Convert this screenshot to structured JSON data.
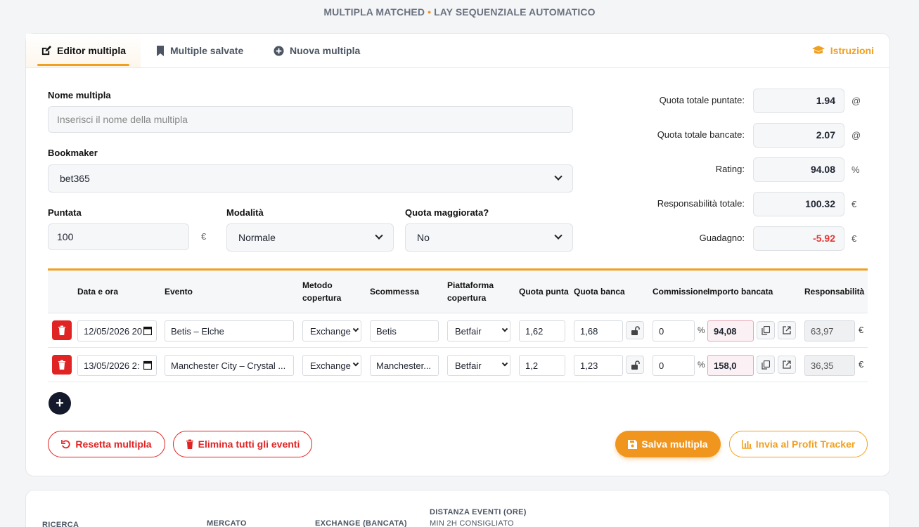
{
  "page": {
    "title": "MULTIPLA MATCHED",
    "separator": "•",
    "subtitle": "LAY SEQUENZIALE AUTOMATICO"
  },
  "tabs": [
    {
      "label": "Editor multipla",
      "icon": "edit-icon",
      "active": true
    },
    {
      "label": "Multiple salvate",
      "icon": "bookmark-icon",
      "active": false
    },
    {
      "label": "Nuova multipla",
      "icon": "plus-circle-icon",
      "active": false
    }
  ],
  "instructions": {
    "label": "Istruzioni",
    "icon": "graduation-cap-icon"
  },
  "form": {
    "name_label": "Nome multipla",
    "name_placeholder": "Inserisci il nome della multipla",
    "bookmaker_label": "Bookmaker",
    "bookmaker_value": "bet365",
    "stake_label": "Puntata",
    "stake_value": "100",
    "stake_unit": "€",
    "mode_label": "Modalità",
    "mode_value": "Normale",
    "boosted_label": "Quota maggiorata?",
    "boosted_value": "No"
  },
  "summary": [
    {
      "label": "Quota totale puntate:",
      "value": "1.94",
      "unit": "@"
    },
    {
      "label": "Quota totale bancate:",
      "value": "2.07",
      "unit": "@"
    },
    {
      "label": "Rating:",
      "value": "94.08",
      "unit": "%"
    },
    {
      "label": "Responsabilità totale:",
      "value": "100.32",
      "unit": "€"
    },
    {
      "label": "Guadagno:",
      "value": "-5.92",
      "unit": "€",
      "color": "#e53935"
    }
  ],
  "table": {
    "headers": {
      "date": "Data e ora",
      "event": "Evento",
      "method_1": "Metodo",
      "method_2": "copertura",
      "bet": "Scommessa",
      "platform_1": "Piattaforma",
      "platform_2": "copertura",
      "back_odds": "Quota punta",
      "lay_odds": "Quota banca",
      "commission": "Commissione",
      "lay_amount": "Importo bancata",
      "liability": "Responsabilità"
    },
    "rows": [
      {
        "date": "12/05/2026 20",
        "event": "Betis – Elche",
        "method": "Exchange",
        "bet": "Betis",
        "platform": "Betfair",
        "back_odds": "1,62",
        "lay_odds": "1,68",
        "commission": "0",
        "commission_unit": "%",
        "lay_amount": "94,08",
        "liability": "63,97",
        "liability_unit": "€"
      },
      {
        "date": "13/05/2026 2:",
        "event": "Manchester City – Crystal ...",
        "method": "Exchange",
        "bet": "Manchester...",
        "platform": "Betfair",
        "back_odds": "1,2",
        "lay_odds": "1,23",
        "commission": "0",
        "commission_unit": "%",
        "lay_amount": "158,0",
        "liability": "36,35",
        "liability_unit": "€"
      }
    ]
  },
  "actions": {
    "add": "+",
    "reset": "Resetta multipla",
    "delete_all": "Elimina tutti gli eventi",
    "save": "Salva multipla",
    "send": "Invia al Profit Tracker"
  },
  "filters": {
    "search": "RICERCA",
    "market": "MERCATO",
    "exchange": "EXCHANGE (BANCATA)",
    "distance_1": "DISTANZA EVENTI (ORE)",
    "distance_2": "MIN 2H CONSIGLIATO"
  },
  "colors": {
    "accent": "#f0a020",
    "danger": "#e02424",
    "dark": "#141a2b"
  }
}
